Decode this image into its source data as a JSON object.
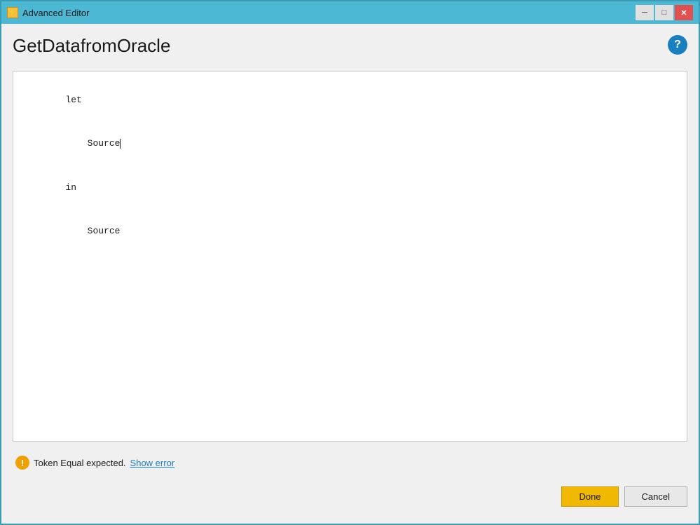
{
  "window": {
    "title": "Advanced Editor",
    "icon": "⚡"
  },
  "titlebar": {
    "minimize_label": "─",
    "maximize_label": "□",
    "close_label": "✕"
  },
  "dialog": {
    "title": "GetDatafromOracle",
    "help_icon": "?"
  },
  "editor": {
    "line1": "let",
    "line2_indent": "    ",
    "line2_text": "Source",
    "line3": "in",
    "line4_indent": "    ",
    "line4_text": "Source"
  },
  "status": {
    "error_icon": "!",
    "error_message": "Token Equal expected.",
    "show_error_link": "Show error"
  },
  "buttons": {
    "done_label": "Done",
    "cancel_label": "Cancel"
  }
}
